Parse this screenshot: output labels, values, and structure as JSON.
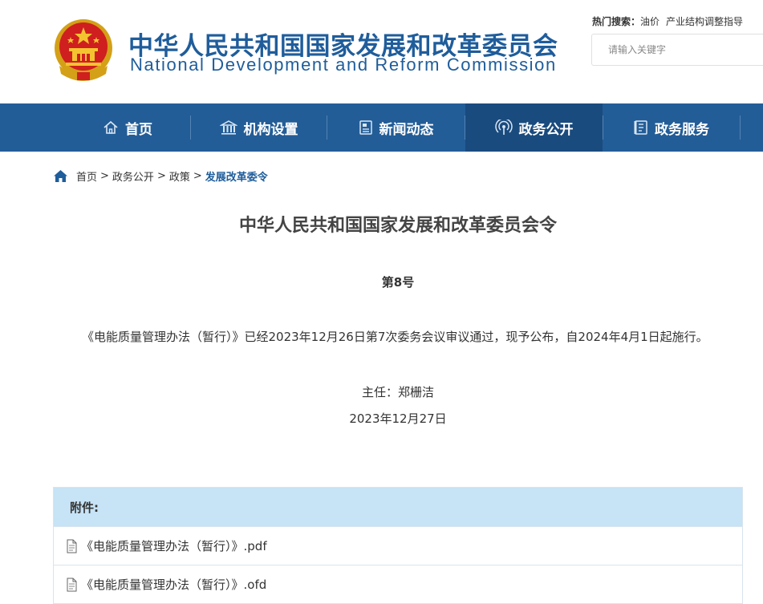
{
  "header": {
    "title_cn": "中华人民共和国国家发展和改革委员会",
    "title_en": "National Development and Reform Commission",
    "hot_label": "热门搜索：",
    "hot_keywords": [
      "油价",
      "产业结构调整指导"
    ],
    "search_placeholder": "请输入关键字"
  },
  "nav": {
    "items": [
      {
        "label": "首页",
        "icon": "home-outline-icon"
      },
      {
        "label": "机构设置",
        "icon": "institution-icon"
      },
      {
        "label": "新闻动态",
        "icon": "news-icon"
      },
      {
        "label": "政务公开",
        "icon": "broadcast-icon",
        "active": true
      },
      {
        "label": "政务服务",
        "icon": "service-doc-icon"
      }
    ]
  },
  "breadcrumb": {
    "items": [
      "首页",
      "政务公开",
      "政策"
    ],
    "current": "发展改革委令",
    "separator": ">"
  },
  "document": {
    "title": "中华人民共和国国家发展和改革委员会令",
    "number": "第8号",
    "body": "《电能质量管理办法（暂行）》已经2023年12月26日第7次委务会议审议通过，现予公布，自2024年4月1日起施行。",
    "signatory": "主任：郑栅洁",
    "date": "2023年12月27日"
  },
  "attachments": {
    "heading": "附件:",
    "files": [
      {
        "name": "《电能质量管理办法（暂行）》.pdf"
      },
      {
        "name": "《电能质量管理办法（暂行）》.ofd"
      }
    ]
  },
  "colors": {
    "brand_blue": "#235d97",
    "nav_active": "#1a4b7e",
    "attachment_header": "#c7e3f6"
  }
}
